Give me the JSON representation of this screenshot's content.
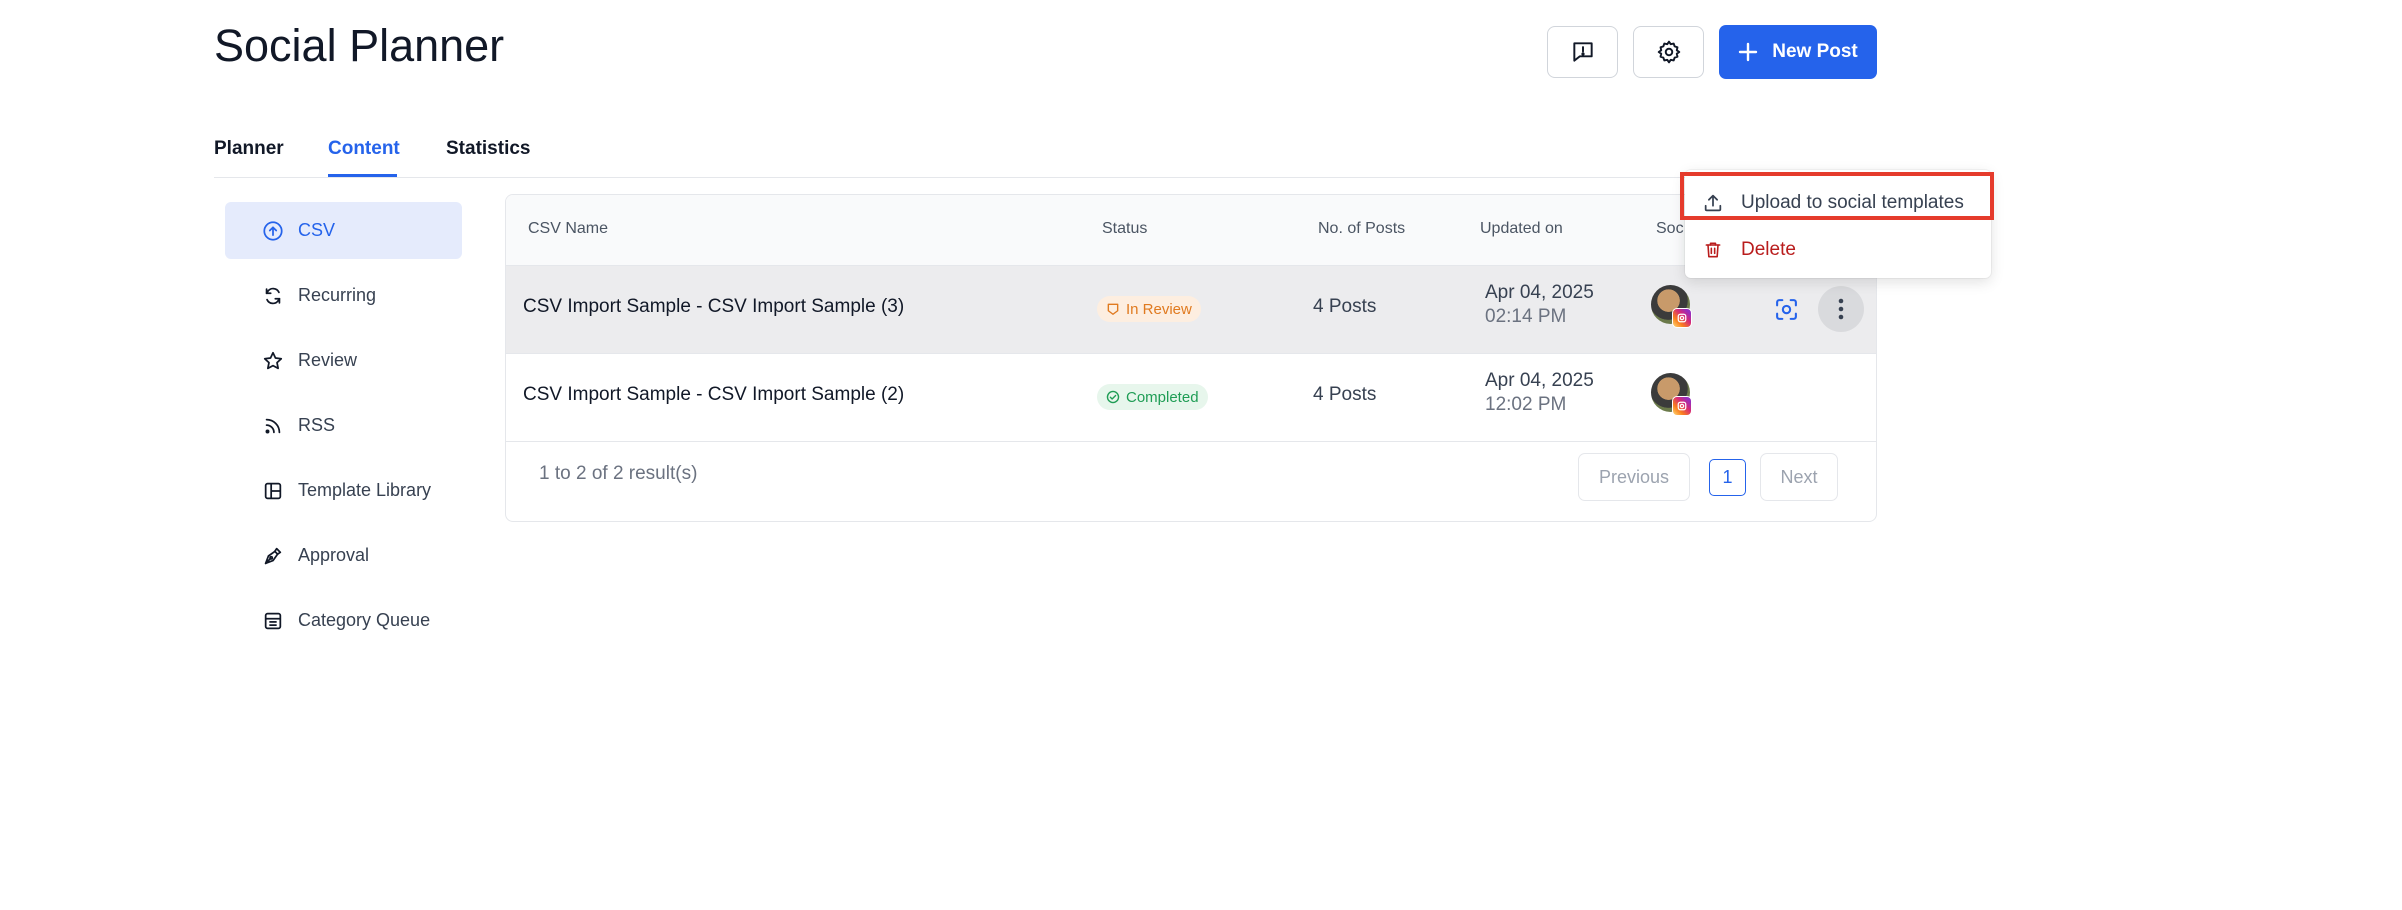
{
  "page": {
    "title": "Social Planner"
  },
  "header": {
    "new_post_label": "New Post"
  },
  "tabs": [
    {
      "label": "Planner"
    },
    {
      "label": "Content",
      "active": true
    },
    {
      "label": "Statistics"
    }
  ],
  "sidebar": {
    "items": [
      {
        "label": "CSV",
        "icon": "upload-circle-icon",
        "active": true
      },
      {
        "label": "Recurring",
        "icon": "recurring-icon"
      },
      {
        "label": "Review",
        "icon": "star-icon"
      },
      {
        "label": "RSS",
        "icon": "rss-icon"
      },
      {
        "label": "Template Library",
        "icon": "template-icon"
      },
      {
        "label": "Approval",
        "icon": "approval-pen-icon"
      },
      {
        "label": "Category Queue",
        "icon": "queue-icon"
      }
    ]
  },
  "table": {
    "columns": [
      "CSV Name",
      "Status",
      "No. of Posts",
      "Updated on",
      "Soc"
    ],
    "rows": [
      {
        "name": "CSV Import Sample - CSV Import Sample (3)",
        "status": "In Review",
        "posts": "4 Posts",
        "date": "Apr 04, 2025",
        "time": "02:14 PM"
      },
      {
        "name": "CSV Import Sample - CSV Import Sample (2)",
        "status": "Completed",
        "posts": "4 Posts",
        "date": "Apr 04, 2025",
        "time": "12:02 PM"
      }
    ]
  },
  "pagination": {
    "summary": "1 to 2 of 2 result(s)",
    "previous": "Previous",
    "current_page": "1",
    "next": "Next"
  },
  "context_menu": {
    "upload_label": "Upload to social templates",
    "delete_label": "Delete"
  },
  "colors": {
    "accent": "#2563eb",
    "review": "#e07a1f",
    "completed": "#1f9d55",
    "delete": "#b91c1c",
    "highlight": "#e53b2c"
  }
}
